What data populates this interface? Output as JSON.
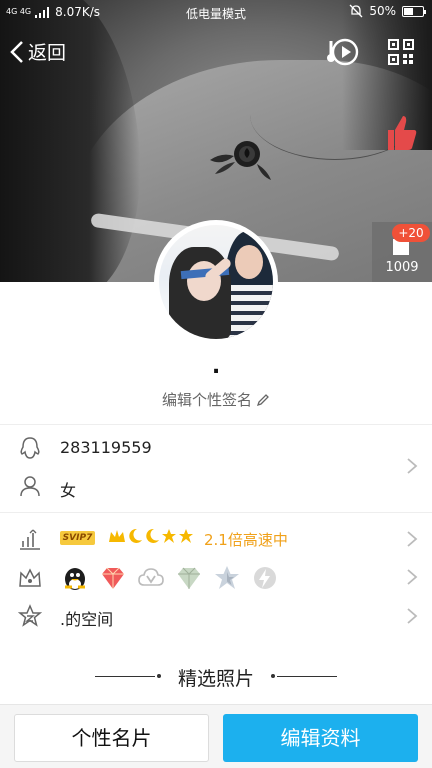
{
  "status_bar": {
    "network": "4G 4G",
    "speed": "8.07K/s",
    "mode": "低电量模式",
    "battery": "50%",
    "battery_level": 0.5
  },
  "nav": {
    "back_label": "返回",
    "music_icon": "music-note-play-icon",
    "qr_icon": "qr-code-icon"
  },
  "likes": {
    "count": "1009",
    "increment": "+20"
  },
  "profile": {
    "nickname": ".",
    "signature_placeholder": "编辑个性签名"
  },
  "info": {
    "qq_number": "283119559",
    "gender": "女"
  },
  "vip": {
    "badge": "SVIP7",
    "speed_text": "2.1倍高速中",
    "level_icons": [
      "crown-icon",
      "moon-icon",
      "moon-icon",
      "star-icon",
      "star-icon"
    ]
  },
  "badges": [
    "qq-penguin-badge",
    "diamond-badge",
    "cloud-badge",
    "green-diamond-badge",
    "star-badge",
    "lightning-badge"
  ],
  "space": {
    "label": ".的空间"
  },
  "section": {
    "title": "精选照片"
  },
  "bottom": {
    "card_label": "个性名片",
    "edit_label": "编辑资料"
  },
  "colors": {
    "accent": "#1cb0ee",
    "badge_red": "#f05138",
    "vip_gold": "#f0a11a"
  }
}
